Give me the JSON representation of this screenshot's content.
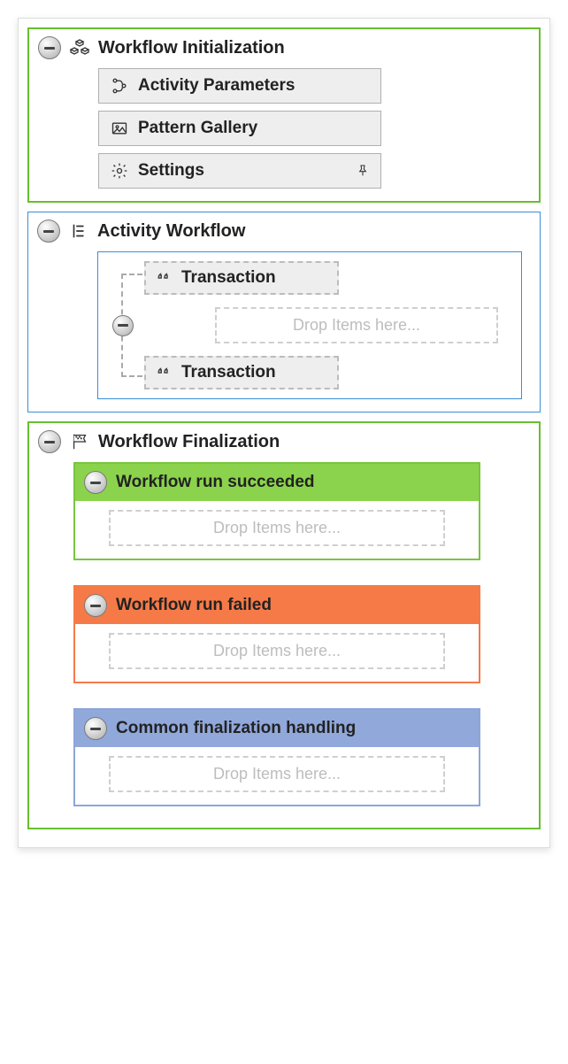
{
  "init": {
    "title": "Workflow Initialization",
    "buttons": {
      "activity_params": "Activity Parameters",
      "pattern_gallery": "Pattern Gallery",
      "settings": "Settings"
    }
  },
  "activity": {
    "title": "Activity Workflow",
    "transaction_label": "Transaction",
    "drop_placeholder": "Drop Items here..."
  },
  "final": {
    "title": "Workflow Finalization",
    "succeeded": "Workflow run succeeded",
    "failed": "Workflow run failed",
    "common": "Common finalization handling",
    "drop_placeholder": "Drop Items here..."
  }
}
